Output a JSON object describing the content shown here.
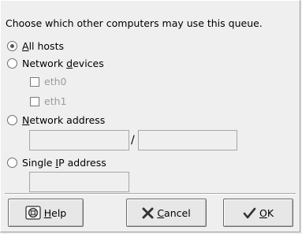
{
  "prompt": "Choose which other computers may use this queue.",
  "options": {
    "all_hosts": {
      "pre": "",
      "mn": "A",
      "post": "ll hosts",
      "checked": true
    },
    "network_devices": {
      "pre": "Network ",
      "mn": "d",
      "post": "evices",
      "checked": false
    },
    "network_address": {
      "pre": "",
      "mn": "N",
      "post": "etwork address",
      "checked": false
    },
    "single_ip": {
      "pre": "Single ",
      "mn": "I",
      "post": "P address",
      "checked": false
    }
  },
  "devices": [
    {
      "label": "eth0",
      "checked": false
    },
    {
      "label": "eth1",
      "checked": false
    }
  ],
  "network_address": {
    "address_value": "",
    "separator": "/",
    "netmask_value": ""
  },
  "single_ip_value": "",
  "buttons": {
    "help": {
      "pre": "",
      "mn": "H",
      "post": "elp",
      "icon": "help-icon"
    },
    "cancel": {
      "pre": "",
      "mn": "C",
      "post": "ancel",
      "icon": "cancel-x-icon"
    },
    "ok": {
      "pre": "",
      "mn": "O",
      "post": "K",
      "icon": "ok-check-icon"
    }
  }
}
